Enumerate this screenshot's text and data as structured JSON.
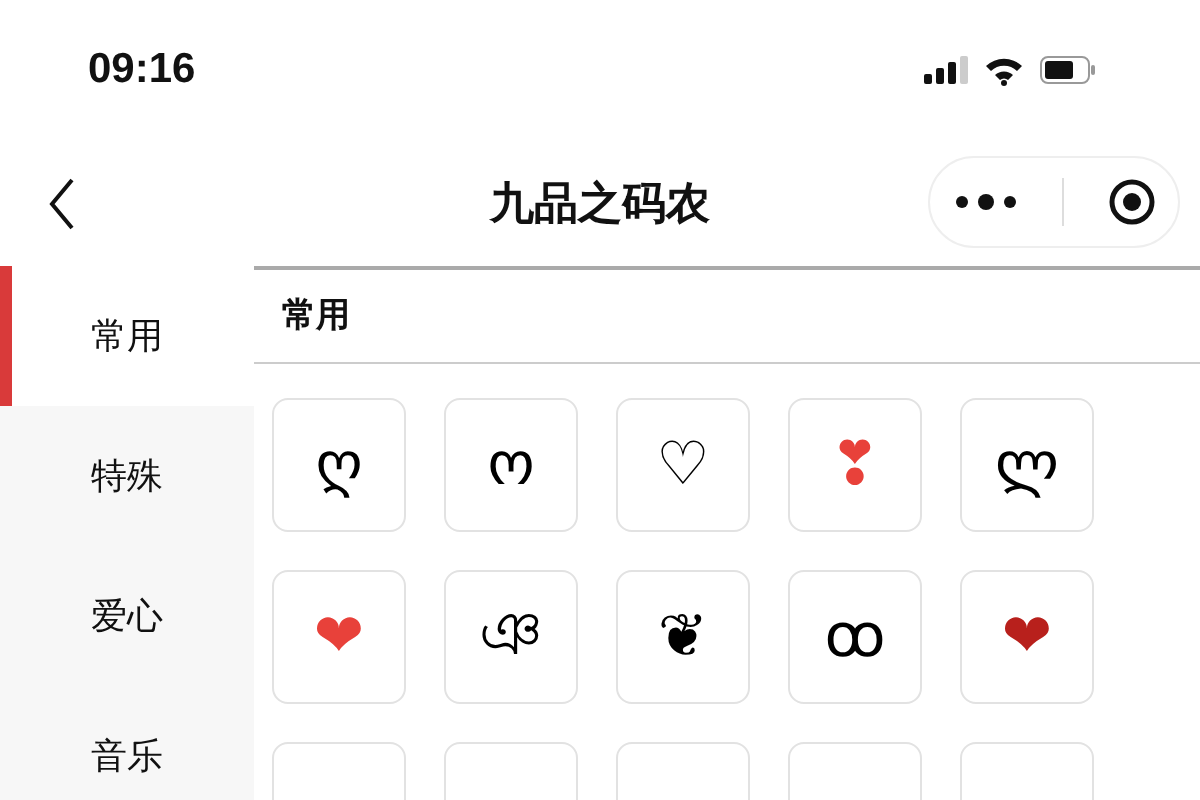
{
  "status_bar": {
    "time": "09:16"
  },
  "nav": {
    "title": "九品之码农"
  },
  "sidebar": {
    "items": [
      {
        "label": "常用",
        "selected": true
      },
      {
        "label": "特殊",
        "selected": false
      },
      {
        "label": "爱心",
        "selected": false
      },
      {
        "label": "音乐",
        "selected": false
      }
    ]
  },
  "section": {
    "title": "常用"
  },
  "symbols": [
    {
      "glyph": "ღ",
      "color": "#000000"
    },
    {
      "glyph": "ო",
      "color": "#000000"
    },
    {
      "glyph": "♡",
      "color": "#000000"
    },
    {
      "glyph": "❣",
      "color": "#e8413a"
    },
    {
      "glyph": "ლ",
      "color": "#000000"
    },
    {
      "glyph": "❤",
      "color": "#e8413a"
    },
    {
      "glyph": "ঞ",
      "color": "#000000"
    },
    {
      "glyph": "❦",
      "color": "#000000"
    },
    {
      "glyph": "ꝏ",
      "color": "#000000"
    },
    {
      "glyph": "❤",
      "color": "#b8201c"
    }
  ]
}
